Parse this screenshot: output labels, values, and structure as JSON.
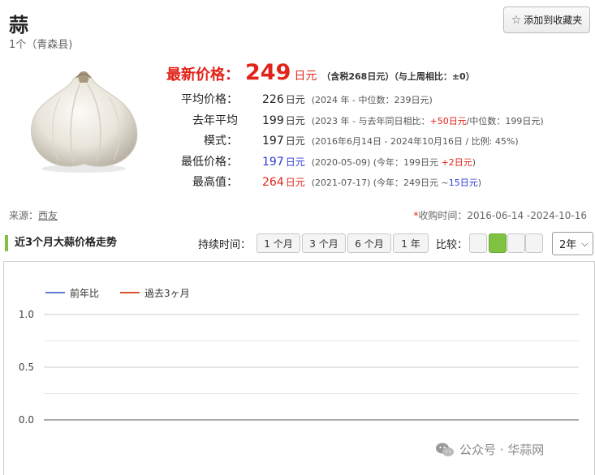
{
  "header": {
    "title": "蒜",
    "subtitle": "1个（青森县)",
    "favorite_label": "添加到收藏夹"
  },
  "prices": {
    "latest_label": "最新价格：",
    "latest_value": "249",
    "latest_unit": "日元",
    "latest_note": "（含税268日元）（与上周相比：±0）",
    "rows": [
      {
        "label": "平均价格：",
        "value": "226",
        "unit": "日元",
        "detail": "(2024 年 - 中位数：239日元)"
      },
      {
        "label": "去年平均",
        "value": "199",
        "unit": "日元",
        "detail_pre": "(2023 年 - 与去年同日相比：",
        "detail_hl": "+50日元",
        "detail_post": "/中位数：199日元)"
      },
      {
        "label": "模式：",
        "value": "197",
        "unit": "日元",
        "detail": "(2016年6月14日 - 2024年10月16日 / 比例: 45%)"
      },
      {
        "label": "最低价格：",
        "value": "197",
        "unit": "日元",
        "detail_pre": "(2020-05-09) (今年：199日元 ",
        "detail_hl": "+2日元",
        "detail_post": ")"
      },
      {
        "label": "最高值：",
        "value": "264",
        "unit": "日元",
        "detail_pre": "(2021-07-17) (今年：249日元 ~",
        "detail_hl": "15日元",
        "detail_post": ")"
      }
    ]
  },
  "source": {
    "label": "来源：",
    "link": "西友"
  },
  "period": {
    "asterisk": "*",
    "text": "收购时间：2016-06-14 -2024-10-16"
  },
  "trend": {
    "title": "近3个月大蒜价格走势",
    "duration_label": "持续时间：",
    "durations": [
      "1 个月",
      "3 个月",
      "6 个月",
      "1 年"
    ],
    "compare_label": "比较：",
    "year_select": "2年"
  },
  "chart_data": {
    "type": "line",
    "series": [
      {
        "name": "前年比",
        "color": "#5b7bd5",
        "values": []
      },
      {
        "name": "過去3ヶ月",
        "color": "#d9532a",
        "values": []
      }
    ],
    "y_ticks": [
      "1.0",
      "0.5",
      "0.0"
    ],
    "ylim": [
      0,
      1.0
    ],
    "grid": true,
    "legend": "top-left"
  },
  "watermark": {
    "text": "公众号 · 华蒜网"
  },
  "colors": {
    "accent_red": "#e2231a",
    "accent_blue": "#2b3bd6",
    "accent_green": "#7fc241"
  }
}
